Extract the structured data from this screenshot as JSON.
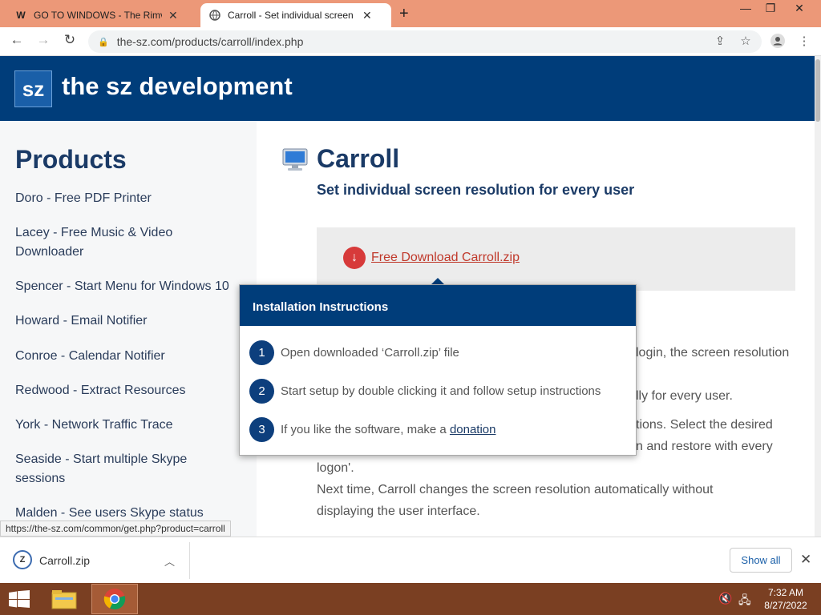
{
  "browser": {
    "tabs": [
      {
        "title": "GO TO WINDOWS - The Rimvydas",
        "favicon": "W",
        "active": false
      },
      {
        "title": "Carroll - Set individual screen res",
        "favicon": "globe",
        "active": true
      }
    ],
    "new_tab_icon": "+",
    "window_controls": [
      "minimize",
      "maximize",
      "close"
    ],
    "url": "the-sz.com/products/carroll/index.php"
  },
  "site": {
    "logo_text": "sz",
    "brand": "the sz development"
  },
  "sidebar": {
    "title": "Products",
    "items": [
      "Doro - Free PDF Printer",
      "Lacey - Free Music & Video Downloader",
      "Spencer - Start Menu for Windows 10",
      "Howard - Email Notifier",
      "Conroe - Calendar Notifier",
      "Redwood - Extract Resources",
      "York - Network Traffic Trace",
      "Seaside - Start multiple Skype sessions",
      "Malden - See users Skype status"
    ]
  },
  "content": {
    "title": "Carroll",
    "subtitle": "Set individual screen resolution for every user",
    "download_link": "Free Download Carroll.zip",
    "para_fragments": [
      "login, the screen resolution",
      "lly for every user.",
      "tions. Select the desired",
      "n and restore with every",
      "logon'.",
      "Next time, Carroll changes the screen resolution automatically without",
      "displaying the user interface."
    ]
  },
  "popup": {
    "header": "Installation Instructions",
    "steps": [
      {
        "num": "1",
        "text": "Open downloaded ‘Carroll.zip’ file"
      },
      {
        "num": "2",
        "text": "Start setup by double clicking it and follow setup instructions"
      },
      {
        "num": "3",
        "text": "If you like the software, make a ",
        "link": "donation"
      }
    ]
  },
  "status_url": "https://the-sz.com/common/get.php?product=carroll",
  "download_bar": {
    "filename": "Carroll.zip",
    "show_all": "Show all"
  },
  "taskbar": {
    "time": "7:32 AM",
    "date": "8/27/2022"
  },
  "colors": {
    "brand_blue": "#003d7a",
    "tab_strip": "#ec9878",
    "taskbar": "#7a3f22",
    "download_red": "#d73a3a"
  }
}
